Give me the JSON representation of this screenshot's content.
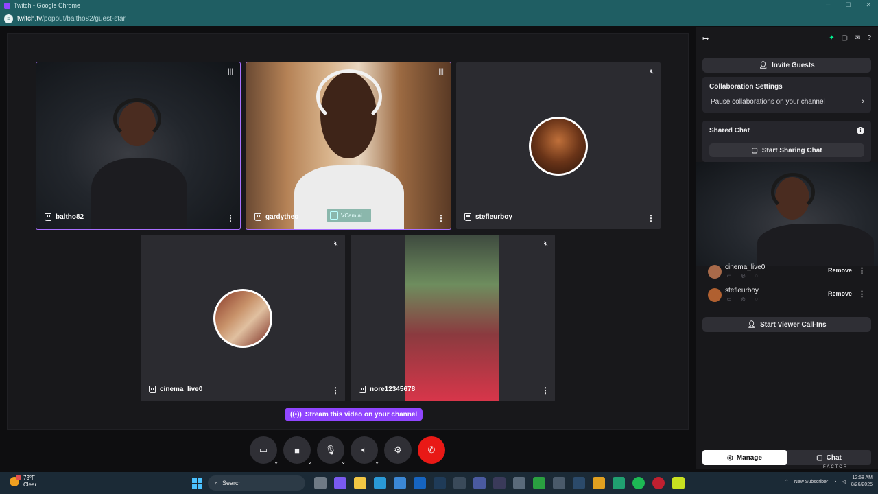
{
  "browser": {
    "title": "Twitch - Google Chrome",
    "url_host": "twitch.tv",
    "url_path": "/popout/baltho82/guest-star"
  },
  "tiles": [
    {
      "name": "baltho82",
      "status_icon": "audio-wave-icon"
    },
    {
      "name": "gardytheo",
      "status_icon": "audio-wave-icon",
      "overlay": "VCam.ai"
    },
    {
      "name": "stefleurboy",
      "status_icon": "mic-muted-icon"
    },
    {
      "name": "cinema_live0",
      "status_icon": "mic-muted-icon"
    },
    {
      "name": "nore12345678",
      "status_icon": "mic-muted-icon"
    }
  ],
  "stream_pill": "Stream this video on your channel",
  "panel": {
    "invite_label": "Invite Guests",
    "collab": {
      "title": "Collaboration Settings",
      "row": "Pause collaborations on your channel"
    },
    "shared_chat": {
      "title": "Shared Chat",
      "button": "Start Sharing Chat"
    },
    "guests": [
      {
        "name": "cinema_live0",
        "action": "Remove"
      },
      {
        "name": "stefleurboy",
        "action": "Remove"
      }
    ],
    "viewer_callins": "Start Viewer Call-Ins",
    "tabs": [
      "Manage",
      "Chat"
    ],
    "pip_overlay": "FACTOR"
  },
  "taskbar": {
    "temp": "73°F",
    "condition": "Clear",
    "search": "Search",
    "tray_notice": "New Subscriber",
    "time": "12:58 AM",
    "date": "8/26/2025"
  }
}
